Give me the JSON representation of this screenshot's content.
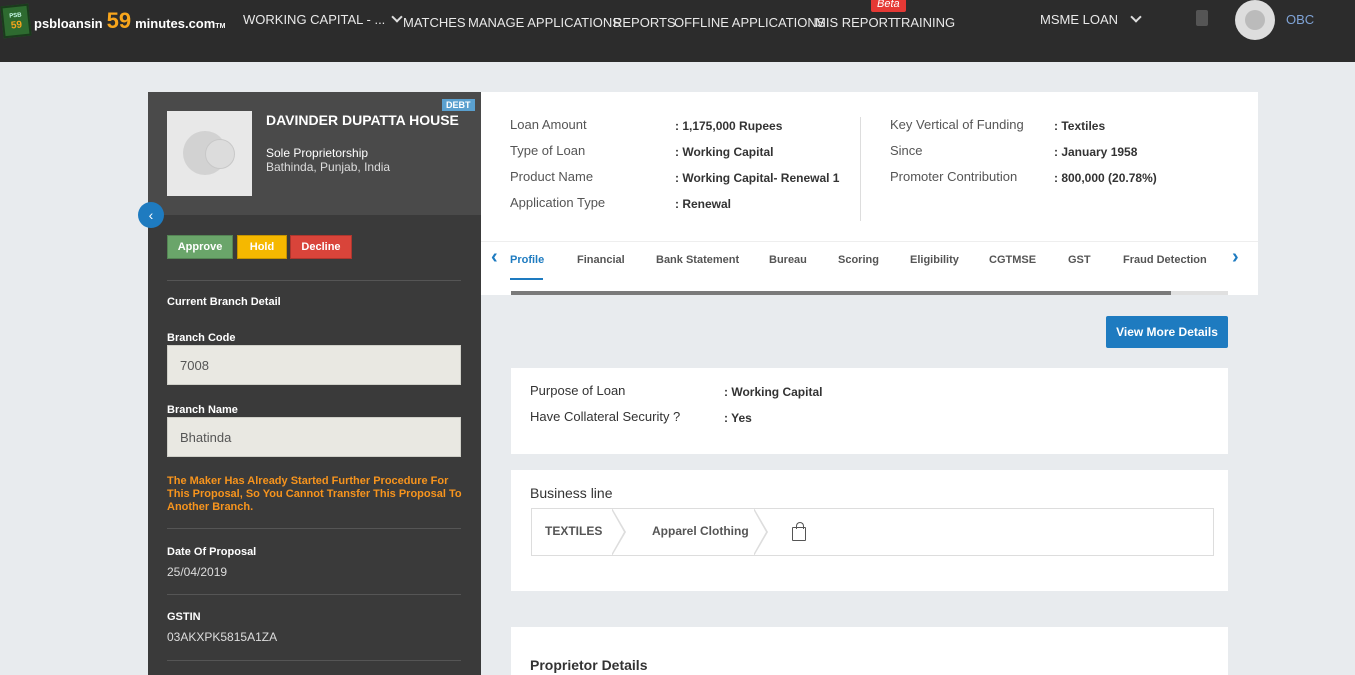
{
  "header": {
    "logo_badge": "59",
    "logo_badge_sub": "PSB",
    "logo_text_1": "psbloansin",
    "logo_text_2": "59",
    "logo_text_3": "minutes.com",
    "logo_tm": "TM",
    "dropdown_label": "WORKING CAPITAL - ...",
    "nav": [
      "MATCHES",
      "MANAGE APPLICATIONS",
      "REPORTS",
      "OFFLINE APPLICATIONS",
      "MIS REPORT",
      "TRAINING"
    ],
    "beta": "Beta",
    "loan_dropdown": "MSME LOAN",
    "bank": "OBC"
  },
  "profile": {
    "badge": "DEBT",
    "name": "DAVINDER DUPATTA HOUSE",
    "type": "Sole Proprietorship",
    "location": "Bathinda, Punjab, India"
  },
  "actions": {
    "approve": "Approve",
    "hold": "Hold",
    "decline": "Decline"
  },
  "branch": {
    "section_title": "Current Branch Detail",
    "code_label": "Branch Code",
    "code_value": "7008",
    "name_label": "Branch Name",
    "name_value": "Bhatinda",
    "warning": "The Maker Has Already Started Further Procedure For This Proposal, So You Cannot Transfer This Proposal To Another Branch.",
    "date_label": "Date Of Proposal",
    "date_value": "25/04/2019",
    "gstin_label": "GSTIN",
    "gstin_value": "03AKXPK5815A1ZA"
  },
  "loan_info": {
    "left": [
      {
        "key": "Loan Amount",
        "value": ": 1,175,000 Rupees"
      },
      {
        "key": "Type of Loan",
        "value": ": Working Capital"
      },
      {
        "key": "Product Name",
        "value": ": Working Capital- Renewal 1"
      },
      {
        "key": "Application Type",
        "value": ": Renewal"
      }
    ],
    "right": [
      {
        "key": "Key Vertical of Funding",
        "value": ": Textiles"
      },
      {
        "key": "Since",
        "value": ": January 1958"
      },
      {
        "key": "Promoter Contribution",
        "value": ": 800,000 (20.78%)"
      }
    ]
  },
  "tabs": [
    "Profile",
    "Financial",
    "Bank Statement",
    "Bureau",
    "Scoring",
    "Eligibility",
    "CGTMSE",
    "GST",
    "Fraud Detection"
  ],
  "tab_scroll_fraction": 0.92,
  "view_more": "View More Details",
  "purpose": [
    {
      "key": "Purpose of Loan",
      "value": ": Working Capital"
    },
    {
      "key": "Have Collateral Security ?",
      "value": ": Yes"
    }
  ],
  "business_line": {
    "title": "Business line",
    "items": [
      "TEXTILES",
      "Apparel Clothing"
    ]
  },
  "proprietor": {
    "title": "Proprietor Details"
  },
  "icons": {
    "collapse": "chevron-left-icon",
    "tab_prev": "chevron-left-icon",
    "tab_next": "chevron-right-icon",
    "bag": "shopping-bag-icon",
    "calculator": "calculator-icon"
  },
  "colors": {
    "topbar": "#2c2c2c",
    "accent": "#1e7bc0",
    "approve": "#6aa56a",
    "hold": "#f5b800",
    "decline": "#d9443a",
    "warning": "#f7941d"
  }
}
